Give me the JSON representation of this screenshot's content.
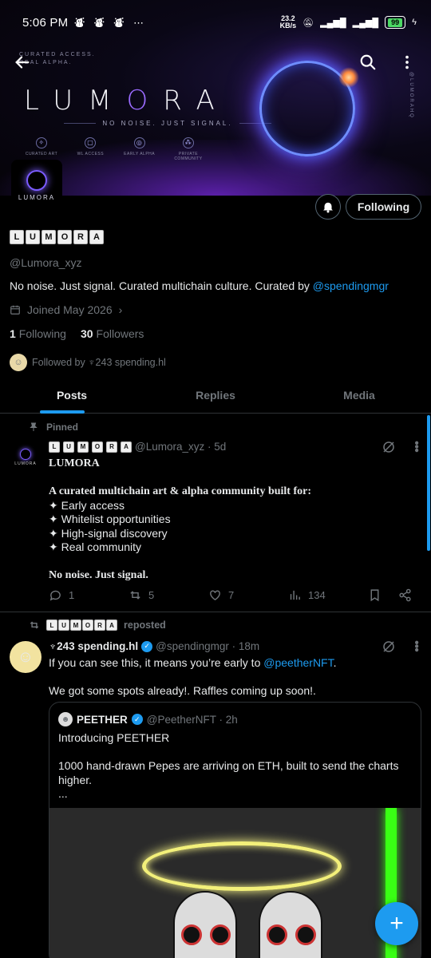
{
  "status": {
    "time": "5:06 PM",
    "speed_top": "23.2",
    "speed_bottom": "KB/s",
    "battery": "99"
  },
  "banner": {
    "small_tag_line1": "CURATED ACCESS.",
    "small_tag_line2": "REAL ALPHA.",
    "brand_pre": "LUM",
    "brand_o": "O",
    "brand_post": "RA",
    "tagline": "NO NOISE. JUST SIGNAL.",
    "features": [
      "CURATED ART",
      "WL ACCESS",
      "EARLY ALPHA",
      "PRIVATE COMMUNITY"
    ],
    "vertical_handle": "@LUMORAHQ"
  },
  "profile": {
    "avatar_text": "LUMORA",
    "name_tiles": [
      "L",
      "U",
      "M",
      "O",
      "R",
      "A"
    ],
    "handle": "@Lumora_xyz",
    "bio_text": "No noise. Just signal.  Curated multichain culture.  Curated by ",
    "bio_link": "@spendingmgr",
    "joined": "Joined May 2026",
    "following_count": "1",
    "following_label": "Following",
    "followers_count": "30",
    "followers_label": "Followers",
    "followed_by": "Followed by ♆243 spending.hl",
    "following_button": "Following"
  },
  "tabs": [
    "Posts",
    "Replies",
    "Media"
  ],
  "pinned_post": {
    "pinned_label": "Pinned",
    "author_tiles": [
      "L",
      "U",
      "M",
      "O",
      "R",
      "A"
    ],
    "handle_time": "@Lumora_xyz · 5d",
    "lines": [
      "LUMORA",
      "",
      "A curated multichain art & alpha community built for:",
      "✦ Early access",
      "✦ Whitelist opportunities",
      "✦ High-signal discovery",
      "✦ Real community",
      "",
      "No noise. Just signal."
    ],
    "replies": "1",
    "reposts": "5",
    "likes": "7",
    "views": "134"
  },
  "repost": {
    "reposted_label": "reposted",
    "reposter_tiles": [
      "L",
      "U",
      "M",
      "O",
      "R",
      "A"
    ],
    "author_name": "♆243 spending.hl",
    "handle_time": "@spendingmgr · 18m",
    "text_prefix": "If you can see this, it means you’re early to ",
    "text_link": "@peetherNFT",
    "text_suffix": ".",
    "text_line2": "We got some spots already!. Raffles coming up soon!."
  },
  "quote": {
    "author_name": "PEETHER",
    "handle_time": "@PeetherNFT · 2h",
    "line1": "Introducing PEETHER",
    "line2": "1000 hand-drawn Pepes are arriving on ETH, built to send the charts higher.",
    "line3": "..."
  },
  "colors": {
    "accent": "#1d9bf0",
    "muted": "#71767b",
    "text": "#e7e9ea",
    "border": "#2f3336"
  }
}
